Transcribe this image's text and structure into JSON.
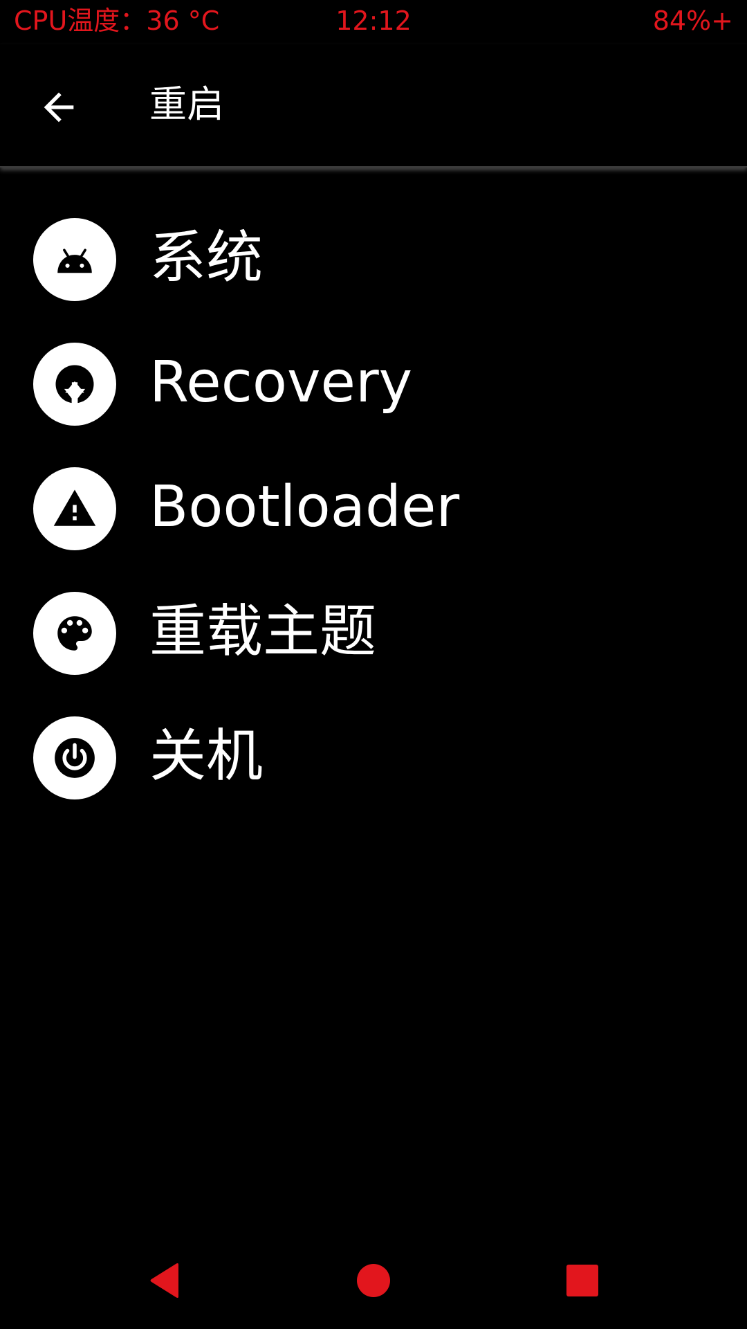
{
  "status_bar": {
    "cpu_temp": "CPU温度：36 °C",
    "time": "12:12",
    "battery": "84%+",
    "text_color": "#e2161d"
  },
  "app_bar": {
    "back_icon": "arrow-back-icon",
    "title": "重启"
  },
  "menu": {
    "items": [
      {
        "label": "系统",
        "icon": "android-icon"
      },
      {
        "label": "Recovery",
        "icon": "recovery-arrows-icon"
      },
      {
        "label": "Bootloader",
        "icon": "warning-triangle-icon"
      },
      {
        "label": "重载主题",
        "icon": "palette-icon"
      },
      {
        "label": "关机",
        "icon": "power-icon"
      }
    ]
  },
  "nav_bar": {
    "back_icon": "triangle-back-icon",
    "home_icon": "circle-home-icon",
    "recents_icon": "square-recents-icon",
    "color": "#e2161d"
  }
}
